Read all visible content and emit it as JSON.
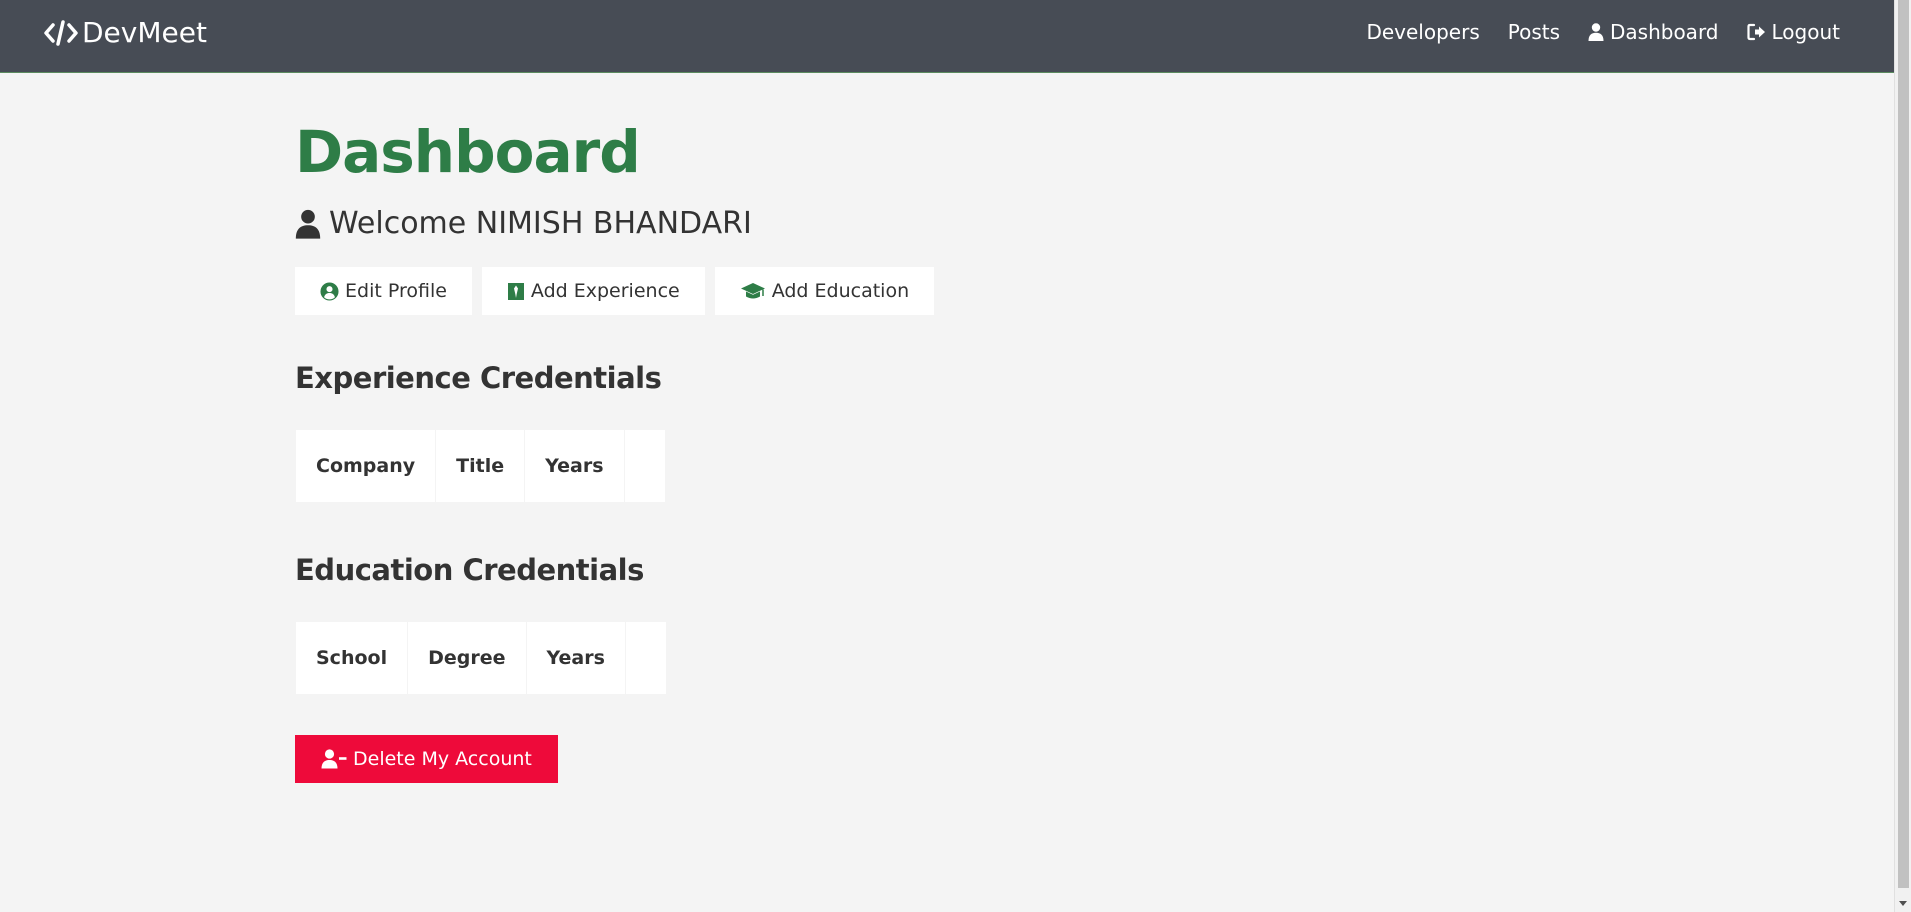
{
  "navbar": {
    "brand": "DevMeet",
    "links": [
      {
        "label": "Developers"
      },
      {
        "label": "Posts"
      },
      {
        "label": "Dashboard",
        "icon": "user-icon"
      },
      {
        "label": "Logout",
        "icon": "logout-icon"
      }
    ]
  },
  "page": {
    "title": "Dashboard",
    "welcome": "Welcome NIMISH BHANDARI"
  },
  "actions": {
    "edit_profile": "Edit Profile",
    "add_experience": "Add Experience",
    "add_education": "Add Education"
  },
  "experience": {
    "title": "Experience Credentials",
    "columns": [
      "Company",
      "Title",
      "Years",
      ""
    ]
  },
  "education": {
    "title": "Education Credentials",
    "columns": [
      "School",
      "Degree",
      "Years",
      ""
    ]
  },
  "delete_account": "Delete My Account",
  "colors": {
    "navbar": "#474c55",
    "primary": "#2e7d47",
    "danger": "#ee0a3a",
    "background": "#f4f4f4"
  }
}
